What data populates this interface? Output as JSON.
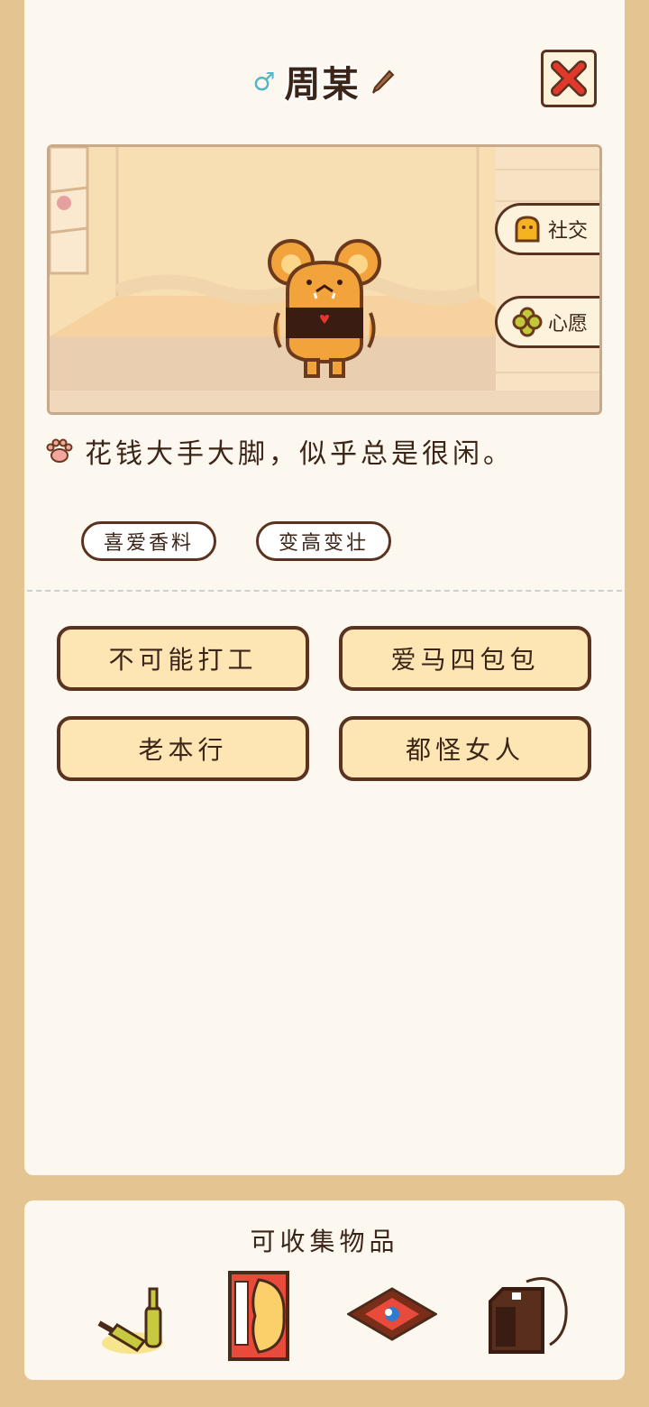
{
  "character": {
    "gender_symbol": "♂",
    "name": "周某",
    "description": "花钱大手大脚，似乎总是很闲。",
    "tags": [
      "喜爱香料",
      "变高变壮"
    ]
  },
  "scene_buttons": {
    "social": "社交",
    "wish": "心愿"
  },
  "traits": [
    "不可能打工",
    "爱马四包包",
    "老本行",
    "都怪女人"
  ],
  "collectibles": {
    "title": "可收集物品",
    "items": [
      "bottles-icon",
      "super-card-icon",
      "rug-icon",
      "bag-icon"
    ]
  },
  "colors": {
    "background": "#e4c591",
    "panel": "#fdf8ef",
    "outline": "#5a3220",
    "button_fill": "#fde6b4",
    "close_x": "#e2382c",
    "gender": "#53b6c8"
  }
}
